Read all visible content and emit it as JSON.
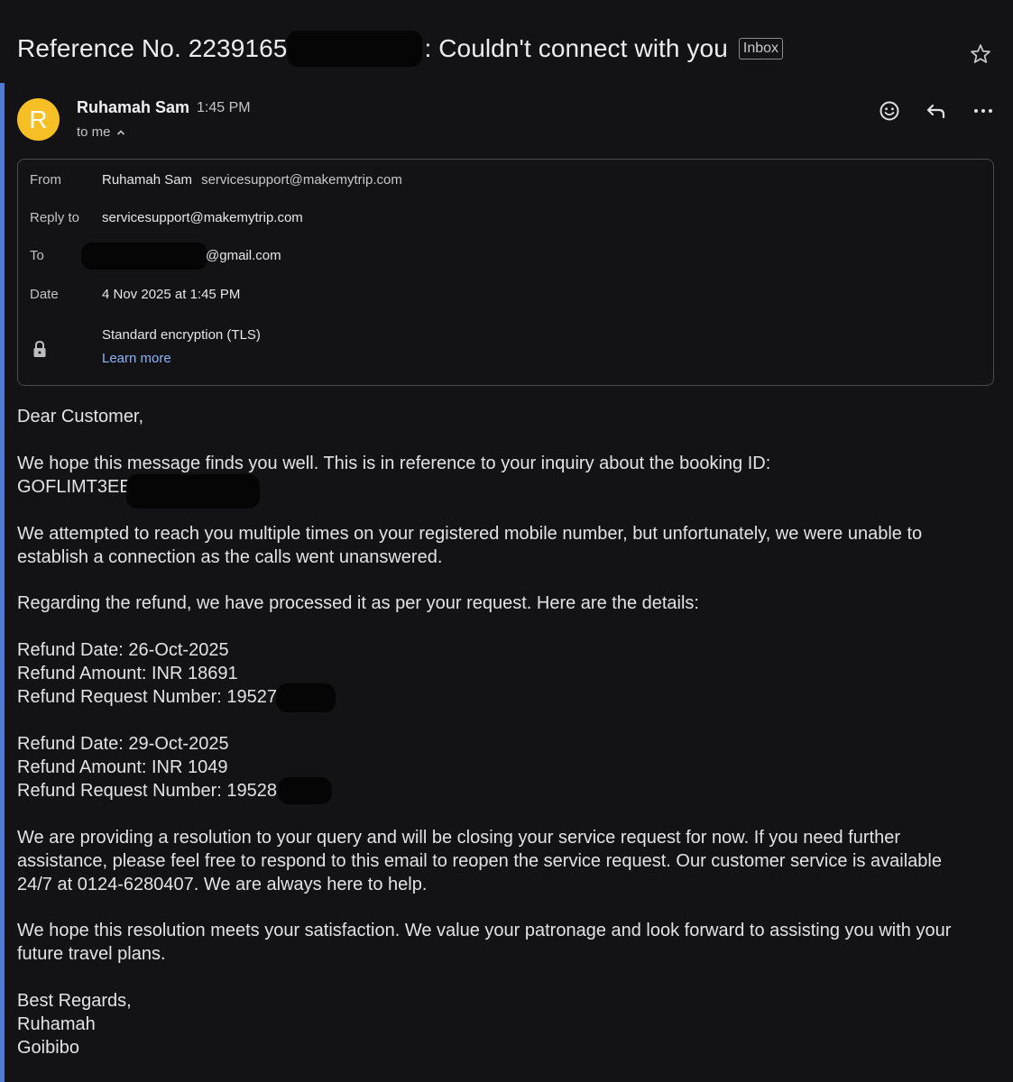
{
  "subject": {
    "prefix": "Reference No. 2239165",
    "suffix": ": Couldn't connect with you",
    "label_badge": "Inbox"
  },
  "message": {
    "avatar_letter": "R",
    "sender_name": "Ruhamah Sam",
    "time": "1:45 PM",
    "recipient_summary": "to me"
  },
  "details": {
    "from_label": "From",
    "from_name": "Ruhamah Sam",
    "from_email": "servicesupport@makemytrip.com",
    "replyto_label": "Reply to",
    "replyto_value": "servicesupport@makemytrip.com",
    "to_label": "To",
    "to_value": "@gmail.com",
    "date_label": "Date",
    "date_value": "4 Nov 2025 at 1:45 PM",
    "encryption": "Standard encryption (TLS)",
    "learn_more": "Learn more"
  },
  "body": {
    "greeting": "Dear Customer,",
    "p1_line1": "We hope this message finds you well. This is in reference to your inquiry about the booking ID:",
    "p1_line2": "GOFLIMT3EE",
    "p2_line1": "We attempted to reach you multiple times on your registered mobile number, but unfortunately, we were unable to",
    "p2_line2": "establish a connection as the calls went unanswered.",
    "p3": "Regarding the refund, we have processed it as per your request. Here are the details:",
    "r1_date": "Refund Date: 26-Oct-2025",
    "r1_amount": "Refund Amount: INR 18691",
    "r1_request": "Refund Request Number: 19527",
    "r2_date": "Refund Date: 29-Oct-2025",
    "r2_amount": "Refund Amount: INR 1049",
    "r2_request": "Refund Request Number: 19528",
    "p4_line1": "We are providing a resolution to your query and will be closing your service request for now. If you need further",
    "p4_line2": "assistance, please feel free to respond to this email to reopen the service request. Our customer service is available",
    "p4_line3": "24/7 at 0124-6280407. We are always here to help.",
    "p5_line1": "We hope this resolution meets your satisfaction. We value your patronage and look forward to assisting you with your",
    "p5_line2": "future travel plans.",
    "sign1": "Best Regards,",
    "sign2": "Ruhamah",
    "sign3": "Goibibo"
  },
  "icons": {
    "back": "chevron-left-icon",
    "star": "star-icon",
    "emoji": "emoji-icon",
    "reply": "reply-icon",
    "more": "more-horizontal-icon",
    "lock": "lock-icon",
    "expand": "chevron-up-icon"
  },
  "colors": {
    "background": "#131316",
    "avatar": "#f6bf26",
    "link": "#8ab4f8",
    "accent": "#4f7ad6"
  }
}
